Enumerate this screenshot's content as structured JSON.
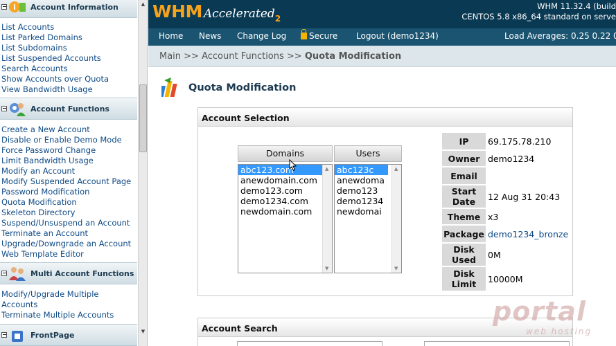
{
  "sidebar": {
    "sections": [
      {
        "title": "Account Information",
        "icon": "info-icon",
        "items": [
          "List Accounts",
          "List Parked Domains",
          "List Subdomains",
          "List Suspended Accounts",
          "Search Accounts",
          "Show Accounts over Quota",
          "View Bandwidth Usage"
        ]
      },
      {
        "title": "Account Functions",
        "icon": "user-gear-icon",
        "items": [
          "Create a New Account",
          "Disable or Enable Demo Mode",
          "Force Password Change",
          "Limit Bandwidth Usage",
          "Modify an Account",
          "Modify Suspended Account Page",
          "Password Modification",
          "Quota Modification",
          "Skeleton Directory",
          "Suspend/Unsuspend an Account",
          "Terminate an Account",
          "Upgrade/Downgrade an Account",
          "Web Template Editor"
        ]
      },
      {
        "title": "Multi Account Functions",
        "icon": "users-icon",
        "items": [
          "Modify/Upgrade Multiple Accounts",
          "Terminate Multiple Accounts"
        ]
      },
      {
        "title": "FrontPage",
        "icon": "frontpage-icon",
        "items": []
      }
    ]
  },
  "header": {
    "logo_main": "WHM",
    "logo_sub": "Accelerated",
    "logo_num": "2",
    "version_line1": "WHM 11.32.4 (build",
    "version_line2": "CENTOS 5.8 x86_64 standard on serve"
  },
  "nav": {
    "items": [
      "Home",
      "News",
      "Change Log",
      "Secure",
      "Logout (demo1234)"
    ],
    "load_averages": "Load Averages: 0.25 0.22 0"
  },
  "breadcrumb": {
    "path": "Main >> Account Functions >> ",
    "current": "Quota Modification"
  },
  "page": {
    "title": "Quota Modification"
  },
  "account_selection": {
    "heading": "Account Selection",
    "domains_label": "Domains",
    "users_label": "Users",
    "domains": [
      "abc123.com",
      "anewdomain.com",
      "demo123.com",
      "demo1234.com",
      "newdomain.com"
    ],
    "users": [
      "abc123c",
      "anewdoma",
      "demo123",
      "demo1234",
      "newdomai"
    ],
    "selected_index": 0,
    "info": [
      {
        "key": "IP",
        "value": "69.175.78.210"
      },
      {
        "key": "Owner",
        "value": "demo1234"
      },
      {
        "key": "Email",
        "value": ""
      },
      {
        "key": "Start Date",
        "value": "12 Aug 31 20:43"
      },
      {
        "key": "Theme",
        "value": "x3"
      },
      {
        "key": "Package",
        "value": "demo1234_bronze"
      },
      {
        "key": "Disk Used",
        "value": "0M"
      },
      {
        "key": "Disk Limit",
        "value": "10000M"
      }
    ]
  },
  "account_search": {
    "heading": "Account Search"
  },
  "watermark": {
    "brand": "portal",
    "tagline": "web hosting"
  }
}
